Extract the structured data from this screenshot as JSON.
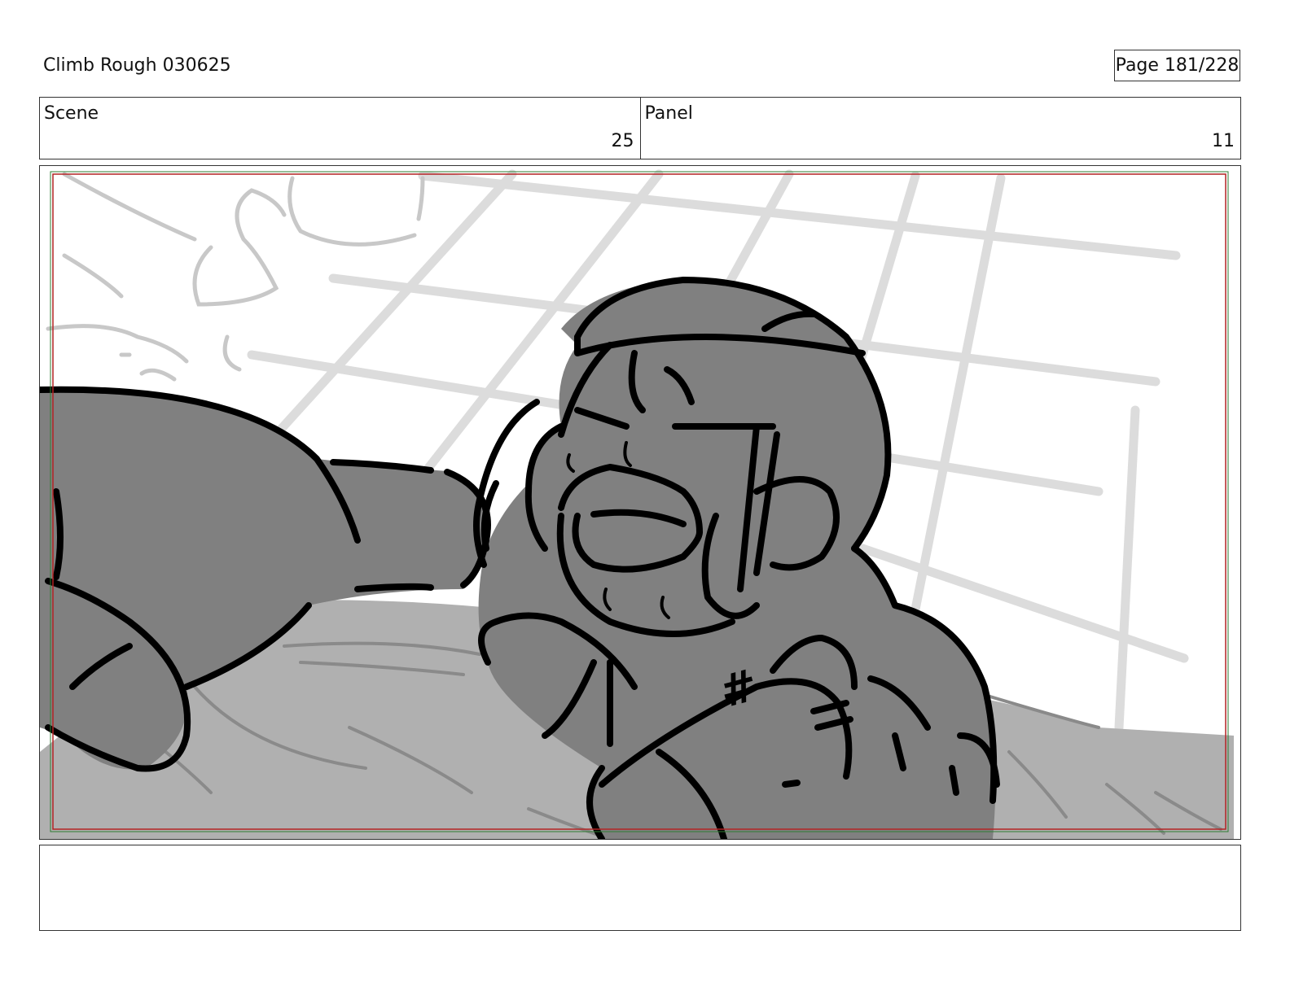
{
  "header": {
    "title": "Climb Rough 030625",
    "page_indicator": "Page 181/228"
  },
  "info": {
    "scene_label": "Scene",
    "scene_value": "25",
    "panel_label": "Panel",
    "panel_value": "11"
  },
  "frame": {
    "sketch_hash_mark": "#"
  },
  "notes": {
    "text": ""
  },
  "colors": {
    "ink": "#000000",
    "character_fill": "#808080",
    "ground_fill": "#b0b0b0",
    "background_lines": "#d9d9d9",
    "safe_frame_red": "#b22222",
    "safe_frame_green": "#2e7d32"
  }
}
